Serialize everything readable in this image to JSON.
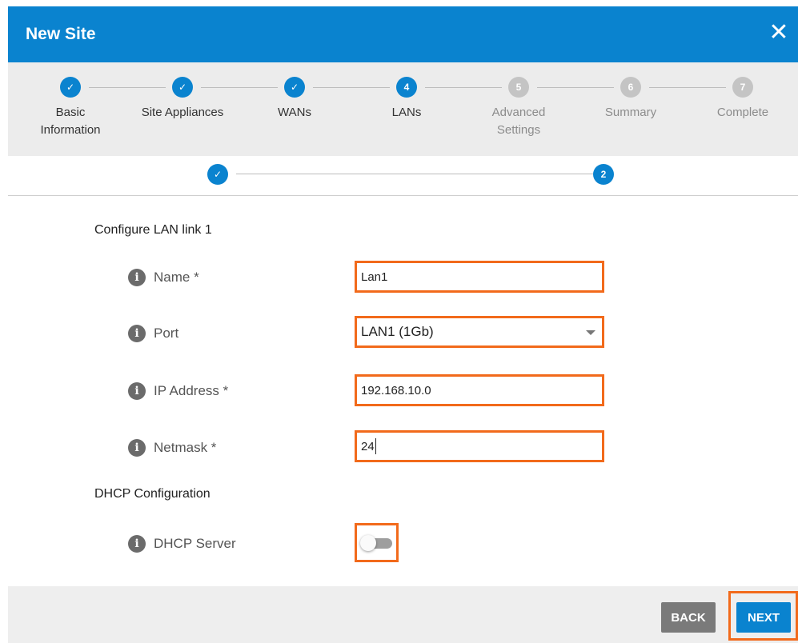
{
  "dialog": {
    "title": "New Site",
    "close_icon": "close-icon"
  },
  "stepper": {
    "steps": [
      {
        "number": "1",
        "label": "Basic Information",
        "state": "done"
      },
      {
        "number": "2",
        "label": "Site Appliances",
        "state": "done"
      },
      {
        "number": "3",
        "label": "WANs",
        "state": "done"
      },
      {
        "number": "4",
        "label": "LANs",
        "state": "active"
      },
      {
        "number": "5",
        "label": "Advanced Settings",
        "state": "pending"
      },
      {
        "number": "6",
        "label": "Summary",
        "state": "pending"
      },
      {
        "number": "7",
        "label": "Complete",
        "state": "pending"
      }
    ]
  },
  "substepper": {
    "steps": [
      {
        "number": "1",
        "state": "done"
      },
      {
        "number": "2",
        "state": "active"
      }
    ]
  },
  "form": {
    "section_lan": "Configure LAN link 1",
    "name": {
      "label": "Name *",
      "value": "Lan1"
    },
    "port": {
      "label": "Port",
      "value": "LAN1 (1Gb)"
    },
    "ip": {
      "label": "IP Address *",
      "value": "192.168.10.0"
    },
    "netmask": {
      "label": "Netmask *",
      "value": "24"
    },
    "section_dhcp": "DHCP Configuration",
    "dhcp_server": {
      "label": "DHCP Server",
      "enabled": false
    }
  },
  "footer": {
    "back_label": "BACK",
    "next_label": "NEXT"
  },
  "colors": {
    "primary": "#0a83cf",
    "highlight": "#f26a1b",
    "pending": "#c4c4c4"
  }
}
